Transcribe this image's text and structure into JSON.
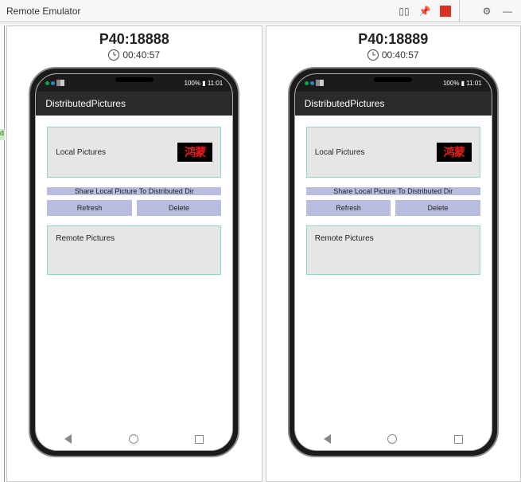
{
  "window": {
    "title": "Remote Emulator",
    "toolbarIcons": {
      "columns": "⬚|⬚",
      "pin": "⚲",
      "gear": "⚙",
      "minimize": "—"
    }
  },
  "devices": [
    {
      "name": "P40:18888",
      "timer": "00:40:57",
      "status": {
        "battery": "100%",
        "time": "11:01",
        "signal_icons": "◦ ◦ ▯▮"
      },
      "app": {
        "title": "DistributedPictures",
        "localLabel": "Local Pictures",
        "thumbText": "鸿蒙",
        "btnShare": "Share Local Picture To Distributed Dir",
        "btnRefresh": "Refresh",
        "btnDelete": "Delete",
        "remoteLabel": "Remote Pictures"
      }
    },
    {
      "name": "P40:18889",
      "timer": "00:40:57",
      "status": {
        "battery": "100%",
        "time": "11:01",
        "signal_icons": "◦ ◦ ▯▮"
      },
      "app": {
        "title": "DistributedPictures",
        "localLabel": "Local Pictures",
        "thumbText": "鸿蒙",
        "btnShare": "Share Local Picture To Distributed Dir",
        "btnRefresh": "Refresh",
        "btnDelete": "Delete",
        "remoteLabel": "Remote Pictures"
      }
    }
  ]
}
